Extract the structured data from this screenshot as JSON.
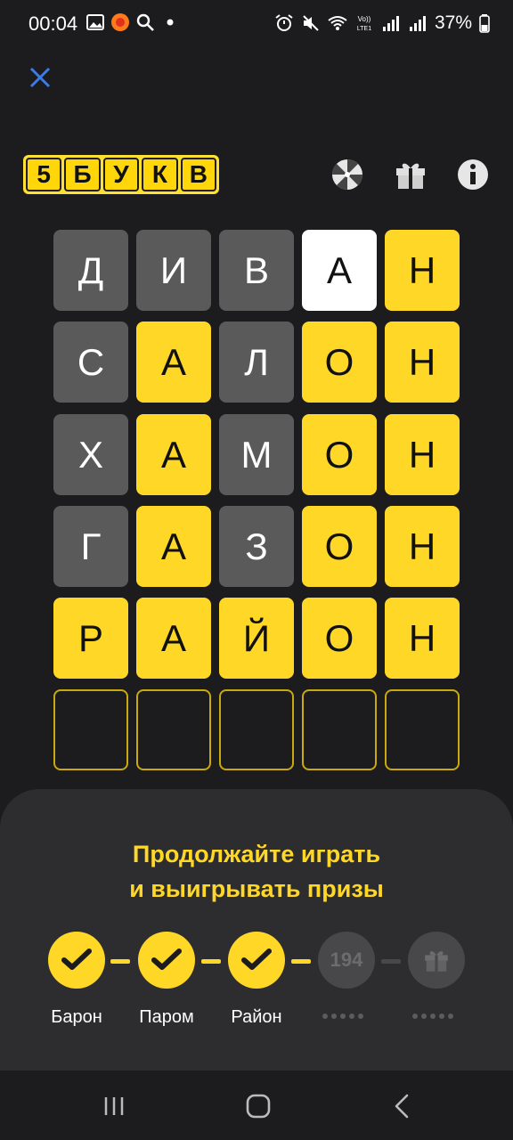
{
  "status_bar": {
    "time": "00:04",
    "battery": "37%",
    "left_icons": [
      "gallery-icon",
      "app-notification-icon",
      "search-icon",
      "dot-icon"
    ],
    "right_icons": [
      "alarm-icon",
      "mute-icon",
      "wifi-icon",
      "volte-icon",
      "signal-icon",
      "signal-icon",
      "battery-icon"
    ]
  },
  "logo": {
    "letters": [
      "5",
      "Б",
      "У",
      "К",
      "В"
    ]
  },
  "grid": {
    "rows": [
      [
        {
          "l": "Д",
          "s": "gray"
        },
        {
          "l": "И",
          "s": "gray"
        },
        {
          "l": "В",
          "s": "gray"
        },
        {
          "l": "А",
          "s": "white"
        },
        {
          "l": "Н",
          "s": "yellow"
        }
      ],
      [
        {
          "l": "С",
          "s": "gray"
        },
        {
          "l": "А",
          "s": "yellow"
        },
        {
          "l": "Л",
          "s": "gray"
        },
        {
          "l": "О",
          "s": "yellow"
        },
        {
          "l": "Н",
          "s": "yellow"
        }
      ],
      [
        {
          "l": "Х",
          "s": "gray"
        },
        {
          "l": "А",
          "s": "yellow"
        },
        {
          "l": "М",
          "s": "gray"
        },
        {
          "l": "О",
          "s": "yellow"
        },
        {
          "l": "Н",
          "s": "yellow"
        }
      ],
      [
        {
          "l": "Г",
          "s": "gray"
        },
        {
          "l": "А",
          "s": "yellow"
        },
        {
          "l": "З",
          "s": "gray"
        },
        {
          "l": "О",
          "s": "yellow"
        },
        {
          "l": "Н",
          "s": "yellow"
        }
      ],
      [
        {
          "l": "Р",
          "s": "yellow"
        },
        {
          "l": "А",
          "s": "yellow"
        },
        {
          "l": "Й",
          "s": "yellow"
        },
        {
          "l": "О",
          "s": "yellow"
        },
        {
          "l": "Н",
          "s": "yellow"
        }
      ],
      [
        {
          "l": "",
          "s": "empty"
        },
        {
          "l": "",
          "s": "empty"
        },
        {
          "l": "",
          "s": "empty"
        },
        {
          "l": "",
          "s": "empty"
        },
        {
          "l": "",
          "s": "empty"
        }
      ]
    ]
  },
  "sheet": {
    "title_line1": "Продолжайте играть",
    "title_line2": "и выигрывать призы",
    "steps": [
      {
        "label": "Барон",
        "state": "done"
      },
      {
        "label": "Паром",
        "state": "done"
      },
      {
        "label": "Район",
        "state": "done"
      },
      {
        "label": "194",
        "state": "pending"
      },
      {
        "label": "",
        "state": "gift"
      }
    ]
  },
  "colors": {
    "background": "#1c1c1e",
    "accent_yellow": "#ffd827",
    "tile_gray": "#5a5a5a",
    "tile_white": "#ffffff",
    "close_blue": "#3d7be8"
  }
}
